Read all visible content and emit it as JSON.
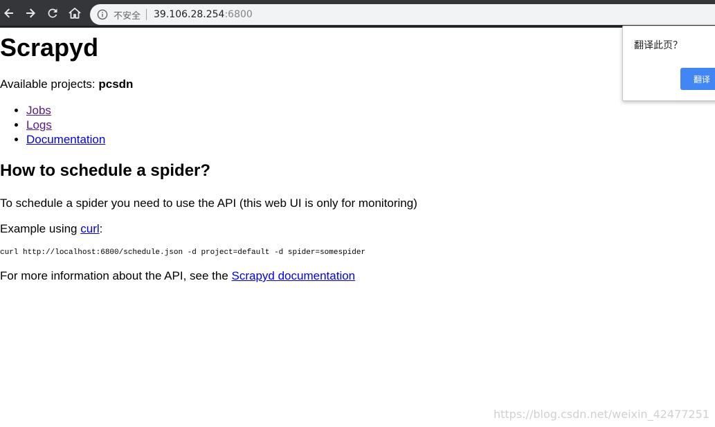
{
  "browser": {
    "security_label": "不安全",
    "url_host": "39.106.28.254",
    "url_port": ":6800",
    "icons": [
      "back-arrow-icon",
      "forward-arrow-icon",
      "reload-icon",
      "home-icon",
      "info-icon"
    ]
  },
  "page": {
    "title": "Scrapyd",
    "projects_prefix": "Available projects: ",
    "projects_value": "pcsdn",
    "links": [
      {
        "label": "Jobs"
      },
      {
        "label": "Logs"
      },
      {
        "label": "Documentation"
      }
    ],
    "section_title": "How to schedule a spider?",
    "schedule_text": "To schedule a spider you need to use the API (this web UI is only for monitoring)",
    "example_prefix": "Example using ",
    "example_link": "curl",
    "example_suffix": ":",
    "code": "curl http://localhost:6800/schedule.json -d project=default -d spider=somespider",
    "more_prefix": "For more information about the API, see the ",
    "more_link": "Scrapyd documentation"
  },
  "translate_popup": {
    "question": "翻译此页？",
    "button_label": "翻译"
  },
  "watermark": "https://blog.csdn.net/weixin_42477251",
  "colors": {
    "toolbar_bg": "#35363a",
    "omnibox_bg": "#f1f3f4",
    "link": "#0000ee",
    "link_visited": "#551a8b",
    "translate_button": "#4285f4"
  }
}
